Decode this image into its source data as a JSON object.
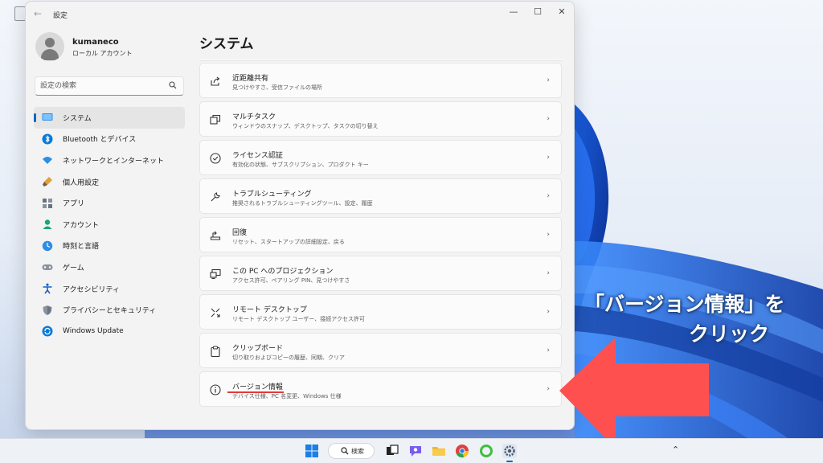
{
  "window": {
    "title": "設定",
    "back_glyph": "←",
    "controls": {
      "minimize": "—",
      "maximize": "☐",
      "close": "✕"
    }
  },
  "profile": {
    "name": "kumaneco",
    "account_type": "ローカル アカウント"
  },
  "search": {
    "placeholder": "設定の検索"
  },
  "sidebar": {
    "items": [
      {
        "label": "システム",
        "icon": "system-icon",
        "active": true
      },
      {
        "label": "Bluetooth とデバイス",
        "icon": "bluetooth-icon"
      },
      {
        "label": "ネットワークとインターネット",
        "icon": "wifi-icon"
      },
      {
        "label": "個人用設定",
        "icon": "paintbrush-icon"
      },
      {
        "label": "アプリ",
        "icon": "apps-icon"
      },
      {
        "label": "アカウント",
        "icon": "account-icon"
      },
      {
        "label": "時刻と言語",
        "icon": "time-language-icon"
      },
      {
        "label": "ゲーム",
        "icon": "gamepad-icon"
      },
      {
        "label": "アクセシビリティ",
        "icon": "accessibility-icon"
      },
      {
        "label": "プライバシーとセキュリティ",
        "icon": "shield-icon"
      },
      {
        "label": "Windows Update",
        "icon": "update-icon"
      }
    ]
  },
  "main": {
    "title": "システム",
    "chevron": "›",
    "cards": [
      {
        "title": "近距離共有",
        "subtitle": "見つけやすさ、受信ファイルの場所",
        "icon": "share-icon"
      },
      {
        "title": "マルチタスク",
        "subtitle": "ウィンドウのスナップ、デスクトップ、タスクの切り替え",
        "icon": "multitask-icon"
      },
      {
        "title": "ライセンス認証",
        "subtitle": "有効化の状態、サブスクリプション、プロダクト キー",
        "icon": "activation-icon"
      },
      {
        "title": "トラブルシューティング",
        "subtitle": "推奨されるトラブルシューティングツール、設定、履歴",
        "icon": "wrench-icon"
      },
      {
        "title": "回復",
        "subtitle": "リセット、スタートアップの詳細設定、戻る",
        "icon": "recovery-icon"
      },
      {
        "title": "この PC へのプロジェクション",
        "subtitle": "アクセス許可、ペアリング PIN、見つけやすさ",
        "icon": "projection-icon"
      },
      {
        "title": "リモート デスクトップ",
        "subtitle": "リモート デスクトップ ユーザー、接続アクセス許可",
        "icon": "remote-desktop-icon"
      },
      {
        "title": "クリップボード",
        "subtitle": "切り取りおよびコピーの履歴、同期、クリア",
        "icon": "clipboard-icon"
      },
      {
        "title": "バージョン情報",
        "subtitle": "デバイス仕様、PC 名変更、Windows 仕様",
        "icon": "info-icon",
        "highlighted": true
      }
    ]
  },
  "annotation": {
    "line1": "「バージョン情報」を",
    "line2": "クリック",
    "color": "#ff5050"
  },
  "taskbar": {
    "search_label": "検索",
    "tray_glyph": "⌃"
  },
  "colors": {
    "accent": "#0067c0",
    "underline": "#e23a3a"
  }
}
